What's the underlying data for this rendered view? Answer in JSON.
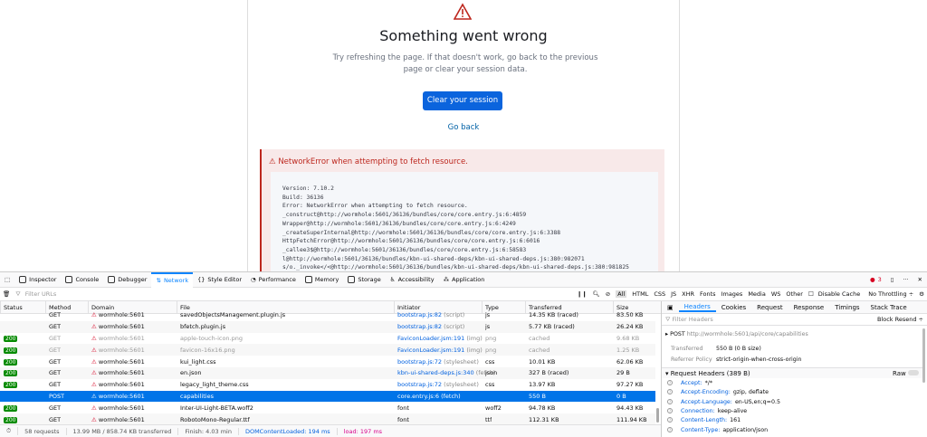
{
  "page": {
    "title": "Something went wrong",
    "message": "Try refreshing the page. If that doesn't work, go back to the previous page or clear your session data.",
    "clear_button": "Clear your session",
    "back_link": "Go back",
    "error_title": "NetworkError when attempting to fetch resource.",
    "stack": "Version: 7.10.2\nBuild: 36136\nError: NetworkError when attempting to fetch resource.\n_construct@http://wormhole:5601/36136/bundles/core/core.entry.js:6:4859\nWrapper@http://wormhole:5601/36136/bundles/core/core.entry.js:6:4249\n_createSuperInternal@http://wormhole:5601/36136/bundles/core/core.entry.js:6:3388\nHttpFetchError@http://wormhole:5601/36136/bundles/core/core.entry.js:6:6016\n_callee3$@http://wormhole:5601/36136/bundles/core/core.entry.js:6:58583\nl@http://wormhole:5601/36136/bundles/kbn-ui-shared-deps/kbn-ui-shared-deps.js:380:982071\ns/o._invoke</<@http://wormhole:5601/36136/bundles/kbn-ui-shared-deps/kbn-ui-shared-deps.js:380:981825"
  },
  "devtools": {
    "tools": [
      "Inspector",
      "Console",
      "Debugger",
      "Network",
      "Style Editor",
      "Performance",
      "Memory",
      "Storage",
      "Accessibility",
      "Application"
    ],
    "error_count": "3",
    "filter_placeholder": "Filter URLs",
    "type_filters": [
      "All",
      "HTML",
      "CSS",
      "JS",
      "XHR",
      "Fonts",
      "Images",
      "Media",
      "WS",
      "Other"
    ],
    "disable_cache": "Disable Cache",
    "throttling": "No Throttling ÷",
    "columns": [
      "Status",
      "Method",
      "Domain",
      "File",
      "Initiator",
      "Type",
      "Transferred",
      "Size"
    ],
    "rows": [
      {
        "status": "",
        "method": "GET",
        "domain": "wormhole:5601",
        "file": "savedObjectsManagement.plugin.js",
        "init": "bootstrap.js:82",
        "init_type": "(script)",
        "type": "js",
        "transferred": "14.35 KB (raced)",
        "size": "83.50 KB"
      },
      {
        "status": "",
        "method": "GET",
        "domain": "wormhole:5601",
        "file": "bfetch.plugin.js",
        "init": "bootstrap.js:82",
        "init_type": "(script)",
        "type": "js",
        "transferred": "5.77 KB (raced)",
        "size": "26.24 KB"
      },
      {
        "status": "200",
        "method": "GET",
        "domain": "wormhole:5601",
        "file": "apple-touch-icon.png",
        "init": "FaviconLoader.jsm:191",
        "init_type": "(img)",
        "type": "png",
        "transferred": "cached",
        "size": "9.68 KB"
      },
      {
        "status": "200",
        "method": "GET",
        "domain": "wormhole:5601",
        "file": "favicon-16x16.png",
        "init": "FaviconLoader.jsm:191",
        "init_type": "(img)",
        "type": "png",
        "transferred": "cached",
        "size": "1.25 KB"
      },
      {
        "status": "200",
        "method": "GET",
        "domain": "wormhole:5601",
        "file": "kui_light.css",
        "init": "bootstrap.js:72",
        "init_type": "(stylesheet)",
        "type": "css",
        "transferred": "10.01 KB",
        "size": "62.06 KB"
      },
      {
        "status": "200",
        "method": "GET",
        "domain": "wormhole:5601",
        "file": "en.json",
        "init": "kbn-ui-shared-deps.js:340",
        "init_type": "(fetch)",
        "type": "json",
        "transferred": "327 B (raced)",
        "size": "29 B"
      },
      {
        "status": "200",
        "method": "GET",
        "domain": "wormhole:5601",
        "file": "legacy_light_theme.css",
        "init": "bootstrap.js:72",
        "init_type": "(stylesheet)",
        "type": "css",
        "transferred": "13.97 KB",
        "size": "97.27 KB"
      },
      {
        "status": "",
        "method": "POST",
        "domain": "wormhole:5601",
        "file": "capabilities",
        "init": "core.entry.js:6",
        "init_type": "(fetch)",
        "type": "",
        "transferred": "550 B",
        "size": "0 B"
      },
      {
        "status": "200",
        "method": "GET",
        "domain": "wormhole:5601",
        "file": "Inter-UI-Light-BETA.woff2",
        "init": "font",
        "init_type": "",
        "type": "woff2",
        "transferred": "94.78 KB",
        "size": "94.43 KB"
      },
      {
        "status": "200",
        "method": "GET",
        "domain": "wormhole:5601",
        "file": "RobotoMono-Regular.ttf",
        "init": "font",
        "init_type": "",
        "type": "ttf",
        "transferred": "112.31 KB",
        "size": "111.94 KB"
      }
    ],
    "status_bar": {
      "requests": "58 requests",
      "transferred": "13.99 MB / 858.74 KB transferred",
      "finish": "Finish: 4.03 min",
      "dcl": "DOMContentLoaded: 194 ms",
      "load": "load: 197 ms"
    },
    "details": {
      "tabs": [
        "Headers",
        "Cookies",
        "Request",
        "Response",
        "Timings",
        "Stack Trace"
      ],
      "filter_placeholder": "Filter Headers",
      "block": "Block",
      "resend": "Resend ÷",
      "method": "POST",
      "url": "http://wormhole:5601/api/core/capabilities",
      "transferred_label": "Transferred",
      "transferred_value": "550 B (0 B size)",
      "referrer_label": "Referrer Policy",
      "referrer_value": "strict-origin-when-cross-origin",
      "req_headers_title": "Request Headers (389 B)",
      "raw": "Raw",
      "headers": [
        {
          "k": "Accept:",
          "v": "*/*"
        },
        {
          "k": "Accept-Encoding:",
          "v": "gzip, deflate"
        },
        {
          "k": "Accept-Language:",
          "v": "en-US,en;q=0.5"
        },
        {
          "k": "Connection:",
          "v": "keep-alive"
        },
        {
          "k": "Content-Length:",
          "v": "161"
        },
        {
          "k": "Content-Type:",
          "v": "application/json"
        }
      ]
    }
  }
}
